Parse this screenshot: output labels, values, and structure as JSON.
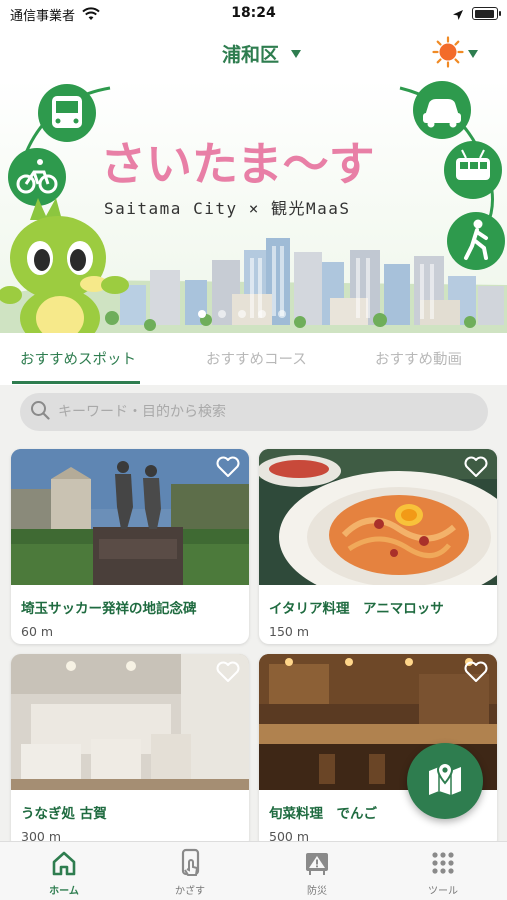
{
  "status_bar": {
    "carrier": "通信事業者",
    "time": "18:24"
  },
  "header": {
    "area": "浦和区",
    "weather_icon": "sun-icon"
  },
  "banner": {
    "logo_text": "さいたま〜す",
    "subtitle": "Saitama City × 観光MaaS",
    "page_count": 5,
    "active_page": 1
  },
  "tabs": [
    {
      "label": "おすすめスポット",
      "active": true
    },
    {
      "label": "おすすめコース",
      "active": false
    },
    {
      "label": "おすすめ動画",
      "active": false
    }
  ],
  "search": {
    "placeholder": "キーワード・目的から検索"
  },
  "cards": [
    {
      "title": "埼玉サッカー発祥の地記念碑",
      "distance": "60 m",
      "image": "monument-photo"
    },
    {
      "title": "イタリア料理　アニマロッサ",
      "distance": "150 m",
      "image": "pasta-photo"
    },
    {
      "title": "うなぎ処 古賀",
      "distance": "300 m",
      "image": "dining-room-photo"
    },
    {
      "title": "旬菜料理　でんご",
      "distance": "500 m",
      "image": "izakaya-counter-photo"
    }
  ],
  "bottom_nav": [
    {
      "label": "ホーム",
      "icon": "home-icon",
      "active": true
    },
    {
      "label": "かざす",
      "icon": "phone-tap-icon",
      "active": false
    },
    {
      "label": "防災",
      "icon": "warning-icon",
      "active": false
    },
    {
      "label": "ツール",
      "icon": "grid-icon",
      "active": false
    }
  ],
  "colors": {
    "brand": "#2e7d4f",
    "background": "#f1f1ef",
    "inactive_tab": "#b8b8b8"
  }
}
